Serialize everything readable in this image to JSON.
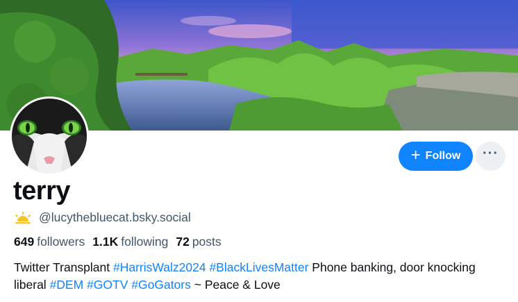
{
  "profile": {
    "display_name": "terry",
    "handle": "@lucythebluecat.bsky.social",
    "handle_badge_icon": "sunrise-icon",
    "stats": {
      "followers_count": "649",
      "followers_label": "followers",
      "following_count": "1.1K",
      "following_label": "following",
      "posts_count": "72",
      "posts_label": "posts"
    },
    "bio": [
      {
        "text": "Twitter Transplant ",
        "type": "text"
      },
      {
        "text": "#HarrisWalz2024",
        "type": "tag"
      },
      {
        "text": " ",
        "type": "text"
      },
      {
        "text": "#BlackLivesMatter",
        "type": "tag"
      },
      {
        "text": " Phone banking, door knocking liberal ",
        "type": "text"
      },
      {
        "text": "#DEM",
        "type": "tag"
      },
      {
        "text": " ",
        "type": "text"
      },
      {
        "text": "#GOTV",
        "type": "tag"
      },
      {
        "text": " ",
        "type": "text"
      },
      {
        "text": "#GoGators",
        "type": "tag"
      },
      {
        "text": " ~ Peace & Love",
        "type": "text"
      }
    ]
  },
  "actions": {
    "follow_label": "Follow",
    "follow_icon": "plus-icon",
    "more_icon": "ellipsis-icon"
  },
  "colors": {
    "accent": "#1083fe",
    "text_primary": "#0b0f14",
    "text_secondary": "#42566b",
    "more_button_bg": "#eef1f4"
  }
}
